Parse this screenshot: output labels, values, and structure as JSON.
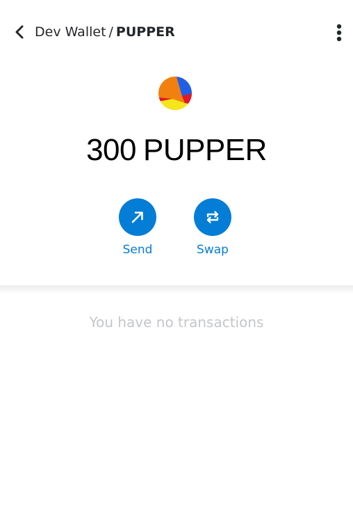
{
  "header": {
    "wallet_name": "Dev Wallet",
    "separator": "/",
    "token_symbol": "PUPPER",
    "back_icon": "chevron-left-icon",
    "menu_icon": "kebab-menu-icon"
  },
  "token": {
    "logo_icon": "multicolor-token-logo",
    "amount": "300",
    "symbol": "PUPPER"
  },
  "actions": [
    {
      "label": "Send",
      "icon": "arrow-up-right-icon"
    },
    {
      "label": "Swap",
      "icon": "swap-arrows-icon"
    }
  ],
  "transactions": {
    "empty_message": "You have no transactions"
  },
  "colors": {
    "primary": "#037dd6",
    "text": "#24272a",
    "muted": "#c4c6c9"
  }
}
